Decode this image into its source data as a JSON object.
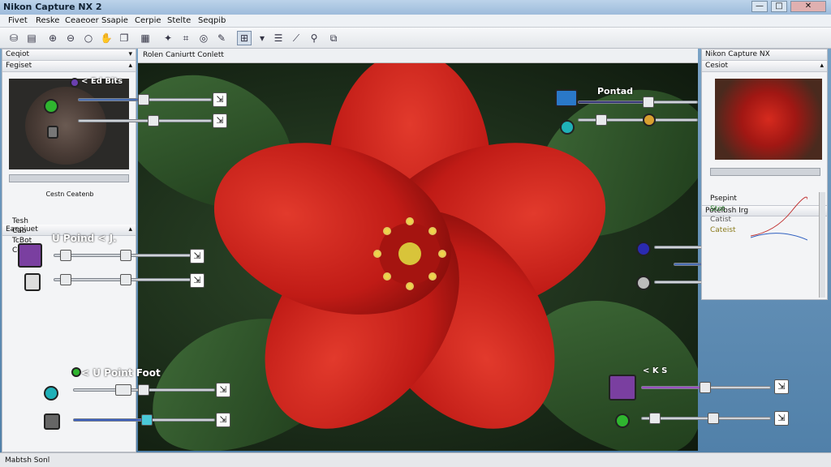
{
  "window": {
    "title": "Nikon Capture NX 2",
    "minimize": "—",
    "maximize": "□",
    "close": "✕"
  },
  "menus": [
    "Fivet",
    "Reske",
    "Ceaeoer",
    "Ssapie",
    "Cerpie",
    "Stelte",
    "Seqpib"
  ],
  "toolbar_icons": [
    "open-icon",
    "print-icon",
    "zoom-in-icon",
    "zoom-out-icon",
    "magnifier-icon",
    "hand-icon",
    "copy-icon",
    "grid-icon",
    "rotate-icon",
    "crop-icon",
    "lasso-icon",
    "brush-icon",
    "settings-icon",
    "control-point-icon",
    "levels-icon",
    "search-icon",
    "stack-icon"
  ],
  "left_panel": {
    "top_header": "Ceqiot",
    "navigator_header": "Fegiset",
    "navigator_caption": "Cestn Ceatenb",
    "edit_list_header": "Eaepiuet",
    "status": "Mabtsh Sonl",
    "control_point_labels": [
      "< Ed Bits",
      "U Poind < J.",
      "< U Point Foot"
    ],
    "list_labels": [
      "Tesh",
      "Cab",
      "TcBot",
      "Ceat"
    ]
  },
  "canvas": {
    "title": "Rolen Caniurtt Conlett"
  },
  "overlay_labels": {
    "top_right": "Pontad",
    "bottom_right": "< K S"
  },
  "right_panel": {
    "title": "Nikon Capture NX",
    "header": "Cesiot",
    "adjust_header": "Potelbsh Irg",
    "adjust_items": [
      "Psepint",
      "Stot",
      "Catist",
      "Cateist"
    ]
  },
  "colors": {
    "accent": "#4a6fb5",
    "flower": "#c8201a",
    "purple": "#7a3fa0",
    "green": "#2fb52f",
    "cyan": "#1fb0b8",
    "blue": "#2a42c8"
  }
}
